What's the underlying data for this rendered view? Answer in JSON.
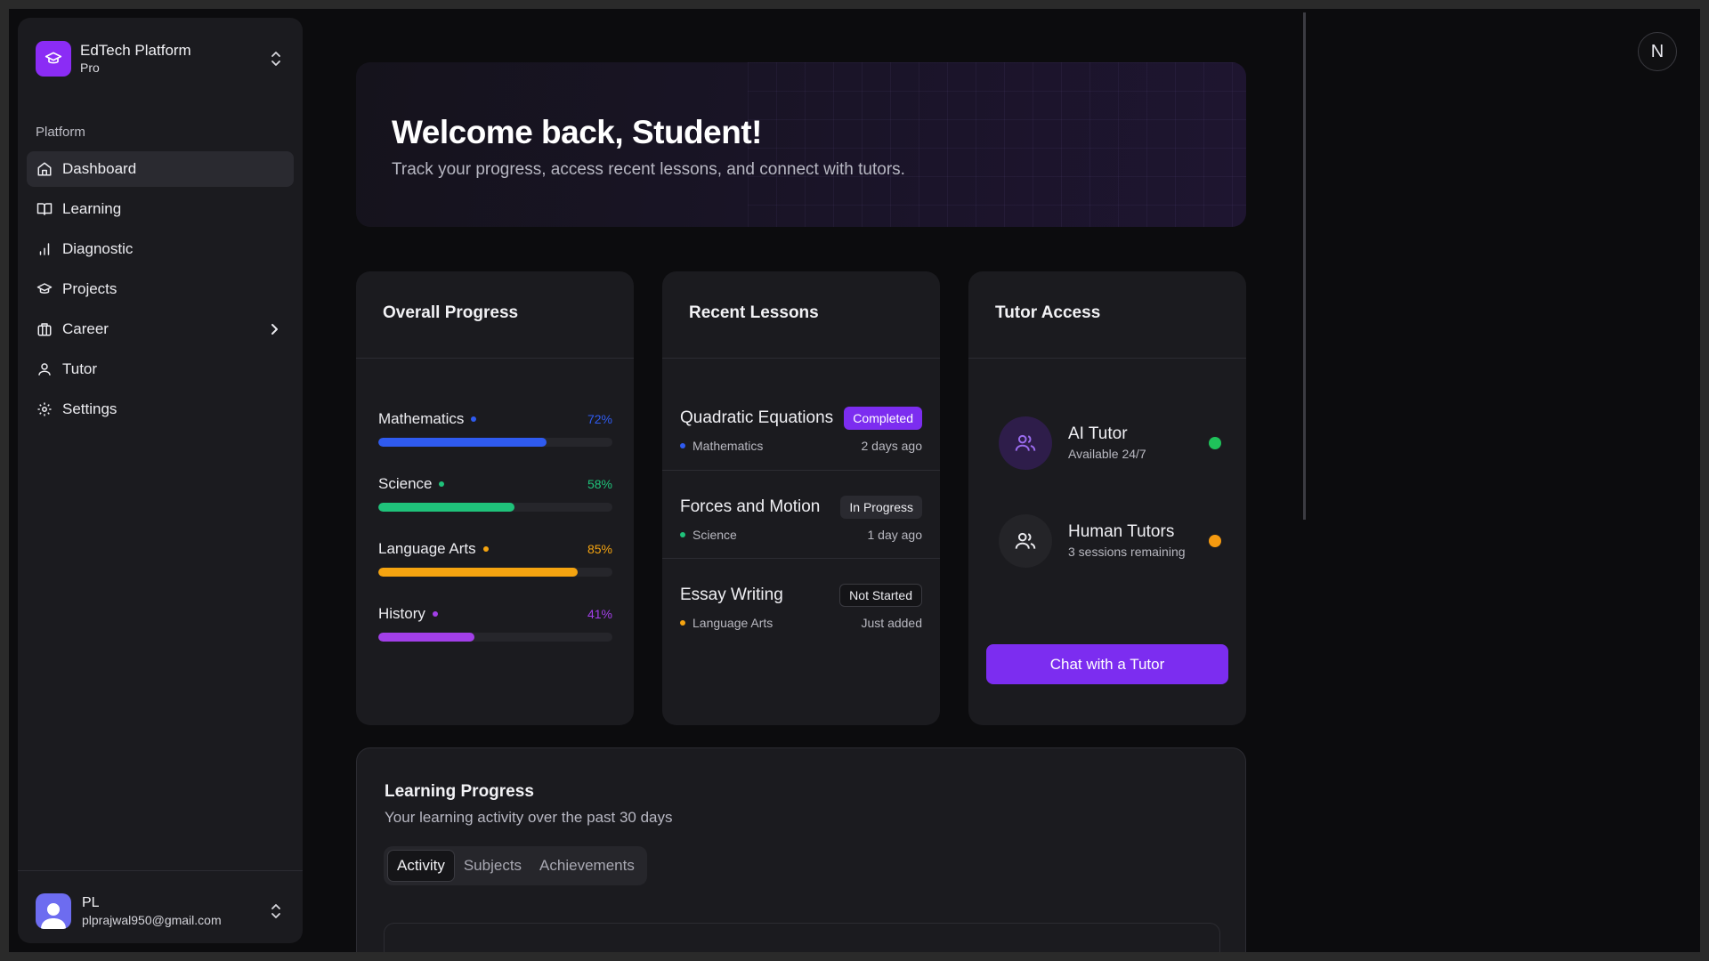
{
  "brand": {
    "name": "EdTech Platform",
    "plan": "Pro"
  },
  "sidebar": {
    "section_label": "Platform",
    "items": [
      {
        "label": "Dashboard",
        "icon": "home-icon"
      },
      {
        "label": "Learning",
        "icon": "book-icon"
      },
      {
        "label": "Diagnostic",
        "icon": "bar-chart-icon"
      },
      {
        "label": "Projects",
        "icon": "graduation-cap-icon"
      },
      {
        "label": "Career",
        "icon": "briefcase-icon"
      },
      {
        "label": "Tutor",
        "icon": "user-icon"
      },
      {
        "label": "Settings",
        "icon": "gear-icon"
      }
    ]
  },
  "user": {
    "initials": "PL",
    "email": "plprajwal950@gmail.com"
  },
  "top_avatar": {
    "initial": "N"
  },
  "hero": {
    "title": "Welcome back, Student!",
    "subtitle": "Track your progress, access recent lessons, and connect with tutors."
  },
  "overall_progress": {
    "title": "Overall Progress",
    "subjects": [
      {
        "name": "Mathematics",
        "percent_label": "72%",
        "progress": 0.72,
        "color": "#2f5bf0"
      },
      {
        "name": "Science",
        "percent_label": "58%",
        "progress": 0.58,
        "color": "#1fc27a"
      },
      {
        "name": "Language Arts",
        "percent_label": "85%",
        "progress": 0.85,
        "color": "#f5a410"
      },
      {
        "name": "History",
        "percent_label": "41%",
        "progress": 0.41,
        "color": "#a23fe8"
      }
    ]
  },
  "recent_lessons": {
    "title": "Recent Lessons",
    "items": [
      {
        "title": "Quadratic Equations",
        "status": "Completed",
        "subject": "Mathematics",
        "subject_color": "#2f5bf0",
        "time": "2 days ago"
      },
      {
        "title": "Forces and Motion",
        "status": "In Progress",
        "subject": "Science",
        "subject_color": "#1fc27a",
        "time": "1 day ago"
      },
      {
        "title": "Essay Writing",
        "status": "Not Started",
        "subject": "Language Arts",
        "subject_color": "#f5a410",
        "time": "Just added"
      }
    ]
  },
  "tutor_access": {
    "title": "Tutor Access",
    "tutors": [
      {
        "name": "AI Tutor",
        "detail": "Available 24/7",
        "status_color": "#1fc25a"
      },
      {
        "name": "Human Tutors",
        "detail": "3 sessions remaining",
        "status_color": "#f59a10"
      }
    ],
    "button": "Chat with a Tutor"
  },
  "learning_progress": {
    "title": "Learning Progress",
    "subtitle": "Your learning activity over the past 30 days",
    "tabs": [
      "Activity",
      "Subjects",
      "Achievements"
    ],
    "active_tab": "Activity"
  },
  "colors": {
    "accent": "#7c2df0",
    "brand_logo": "#8b2cf5",
    "background": "#0c0c0e",
    "card": "#1b1b1f"
  }
}
